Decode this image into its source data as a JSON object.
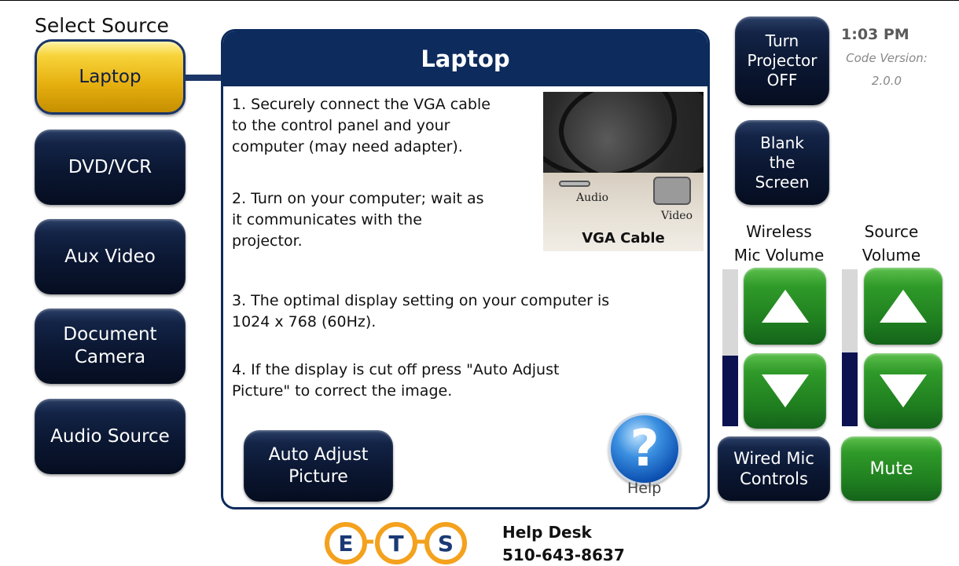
{
  "select_source": {
    "title": "Select Source",
    "items": [
      {
        "label": "Laptop",
        "active": true
      },
      {
        "label": "DVD/VCR"
      },
      {
        "label": "Aux Video"
      },
      {
        "label": "Document\nCamera"
      },
      {
        "label": "Audio Source"
      }
    ]
  },
  "panel": {
    "title": "Laptop",
    "steps": [
      "1. Securely connect the VGA cable\nto the control panel and your\ncomputer (may need adapter).",
      "2. Turn on your computer; wait as\nit communicates with the\nprojector.",
      "3. The optimal display setting on your computer is\n1024 x 768 (60Hz).",
      "4. If the display is cut off press \"Auto Adjust\nPicture\" to correct the image."
    ],
    "photo": {
      "audio_label": "Audio",
      "video_label": "Video",
      "caption": "VGA Cable"
    },
    "auto_adjust_label": "Auto Adjust\nPicture",
    "help_symbol": "?",
    "help_label": "Help"
  },
  "controls": {
    "projector_off_label": "Turn\nProjector\nOFF",
    "blank_screen_label": "Blank\nthe\nScreen",
    "time": "1:03 PM",
    "code_version_label": "Code Version:",
    "code_version": "2.0.0",
    "wireless_mic_title": "Wireless\nMic Volume",
    "source_volume_title": "Source\nVolume",
    "wireless_mic_level": 0.45,
    "source_volume_level": 0.47,
    "wired_mic_label": "Wired Mic\nControls",
    "mute_label": "Mute"
  },
  "footer": {
    "logo_letters": [
      "E",
      "T",
      "S"
    ],
    "helpdesk_title": "Help Desk",
    "helpdesk_phone": "510-643-8637"
  },
  "colors": {
    "navy": "#0d2b5c",
    "gold": "#e6b010",
    "green": "#1f7e1f",
    "meter_fill": "#0c1250",
    "logo_orange": "#f4a11d"
  }
}
